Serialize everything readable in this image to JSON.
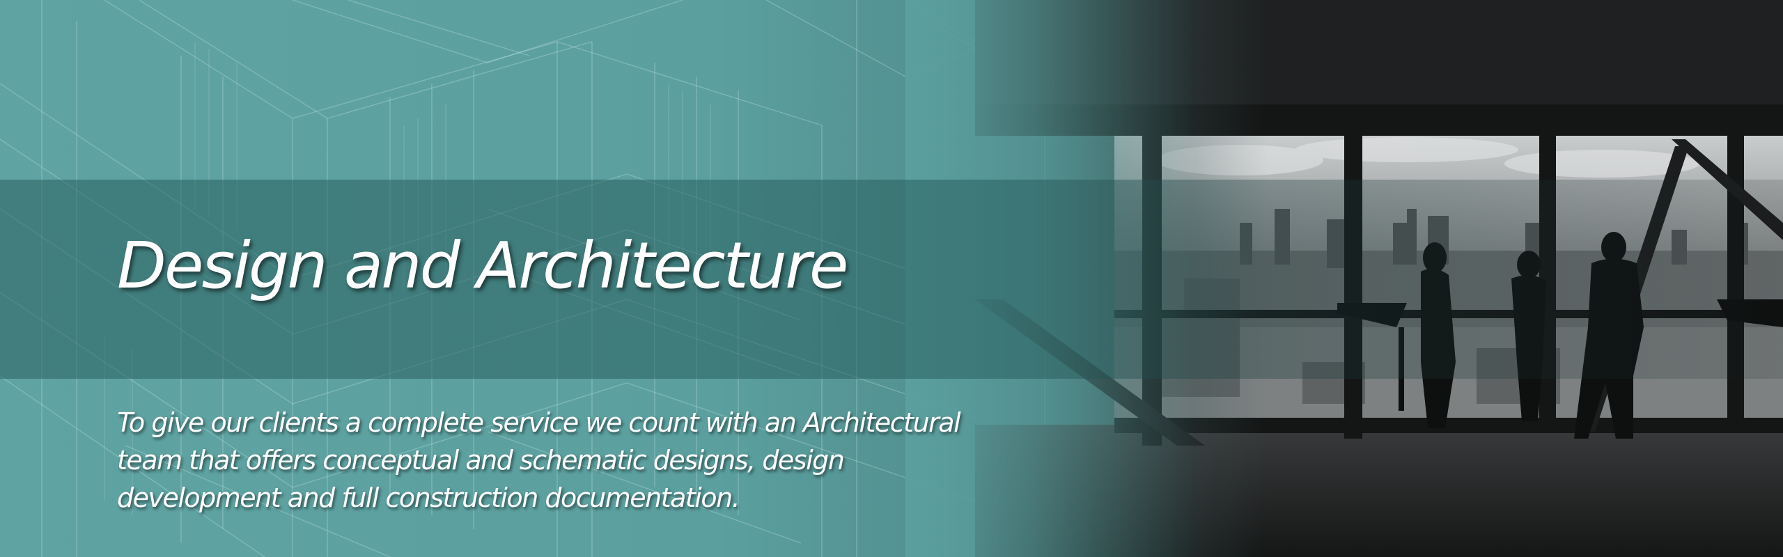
{
  "banner": {
    "title": "Design and Architecture",
    "description_lines": [
      "To give our clients a complete service we count with an Architectural",
      "team that offers conceptual and schematic designs, design",
      "development and full construction documentation."
    ]
  },
  "colors": {
    "teal": "#5ba09f",
    "band": "#2f6b6b",
    "photo_dark": "#1f2021",
    "text": "#ffffff"
  }
}
